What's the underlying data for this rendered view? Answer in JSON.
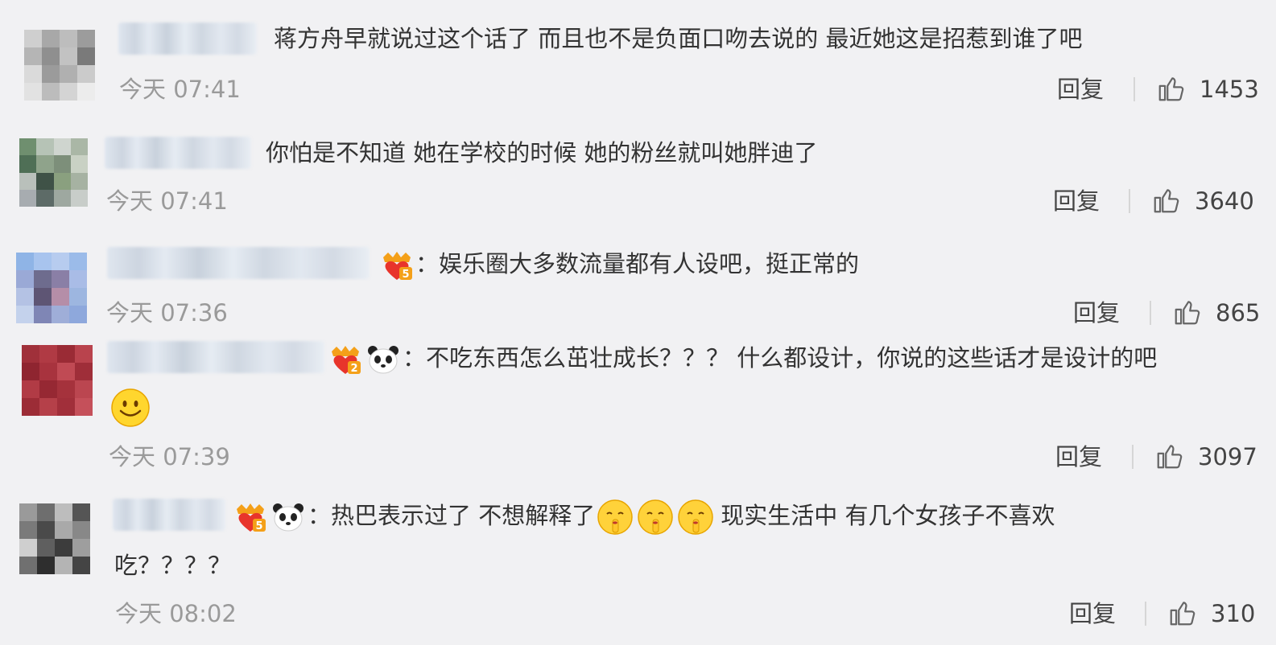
{
  "comments": [
    {
      "text": "蒋方舟早就说过这个话了 而且也不是负面口吻去说的 最近她这是招惹到谁了吧",
      "time": "今天 07:41",
      "reply": "回复",
      "likes": "1453"
    },
    {
      "text": "你怕是不知道 她在学校的时候 她的粉丝就叫她胖迪了",
      "time": "今天 07:41",
      "reply": "回复",
      "likes": "3640"
    },
    {
      "text": "：娱乐圈大多数流量都有人设吧，挺正常的",
      "time": "今天 07:36",
      "reply": "回复",
      "likes": "865",
      "badge_level": "5"
    },
    {
      "text": "：不吃东西怎么茁壮成长？？？ 什么都设计，你说的这些话才是设计的吧",
      "time": "今天 07:39",
      "reply": "回复",
      "likes": "3097",
      "badge_level": "2"
    },
    {
      "text_part1": "：热巴表示过了 不想解释了",
      "text_part2": "现实生活中 有几个女孩子不喜欢",
      "text_line2": "吃？？？？",
      "time": "今天 08:02",
      "reply": "回复",
      "likes": "310",
      "badge_level": "5"
    }
  ],
  "icons": {
    "like": "thumbs-up-icon",
    "badge": "crown-heart-badge-icon",
    "panda": "panda-icon",
    "smile": "smile-emoji-icon",
    "shush": "shush-emoji-icon"
  },
  "colors": {
    "background": "#f1f1f3",
    "time": "#9a9a9a",
    "badge": "#f4a019"
  }
}
